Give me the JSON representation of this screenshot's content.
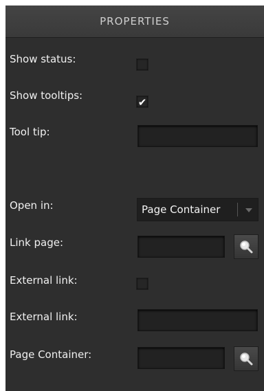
{
  "panel": {
    "title": "PROPERTIES"
  },
  "fields": {
    "show_status": {
      "label": "Show status:",
      "checked": false
    },
    "show_tooltips": {
      "label": "Show tooltips:",
      "checked": true,
      "mark": "✔"
    },
    "tool_tip": {
      "label": "Tool tip:",
      "value": ""
    },
    "open_in": {
      "label": "Open in:",
      "value": "Page Container"
    },
    "link_page": {
      "label": "Link page:",
      "value": ""
    },
    "external_link_toggle": {
      "label": "External link:",
      "checked": false
    },
    "external_link": {
      "label": "External link:",
      "value": ""
    },
    "page_container": {
      "label": "Page Container:",
      "value": ""
    }
  },
  "icons": {
    "search": "search-icon",
    "dropdown": "chevron-down-icon",
    "check": "checkmark-icon"
  },
  "colors": {
    "panel_bg": "#2e2e2e",
    "header_bg": "#3e3e3e",
    "field_bg": "#222222",
    "text": "#f0f0f0"
  }
}
